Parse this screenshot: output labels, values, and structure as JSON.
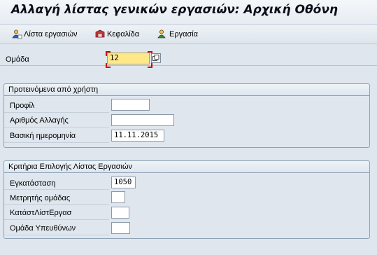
{
  "window": {
    "title": "Αλλαγή λίστας γενικών εργασιών: Αρχική Οθόνη"
  },
  "toolbar": {
    "items": [
      {
        "label": "Λίστα εργασιών",
        "icon": "task-list-icon"
      },
      {
        "label": "Κεφαλίδα",
        "icon": "header-icon"
      },
      {
        "label": "Εργασία",
        "icon": "operation-icon"
      }
    ]
  },
  "group_field": {
    "label": "Ομάδα",
    "value": "12"
  },
  "user_defaults": {
    "title": "Προτεινόμενα από χρήστη",
    "profile": {
      "label": "Προφίλ",
      "value": ""
    },
    "change_number": {
      "label": "Αριθμός Αλλαγής",
      "value": ""
    },
    "key_date": {
      "label": "Βασική ημερομηνία",
      "value": "11.11.2015"
    }
  },
  "selection_criteria": {
    "title": "Κριτήρια Επιλογής Λίστας Εργασιών",
    "plant": {
      "label": "Εγκατάσταση",
      "value": "1050"
    },
    "group_counter": {
      "label": "Μετρητής ομάδας",
      "value": ""
    },
    "task_list_status": {
      "label": "ΚατάστΛίστΕργασ",
      "value": ""
    },
    "responsible_group": {
      "label": "Ομάδα Υπευθύνων",
      "value": ""
    }
  },
  "colors": {
    "background": "#dfe6ee",
    "focus_field": "#ffe88a",
    "focus_marker": "#d00000"
  }
}
